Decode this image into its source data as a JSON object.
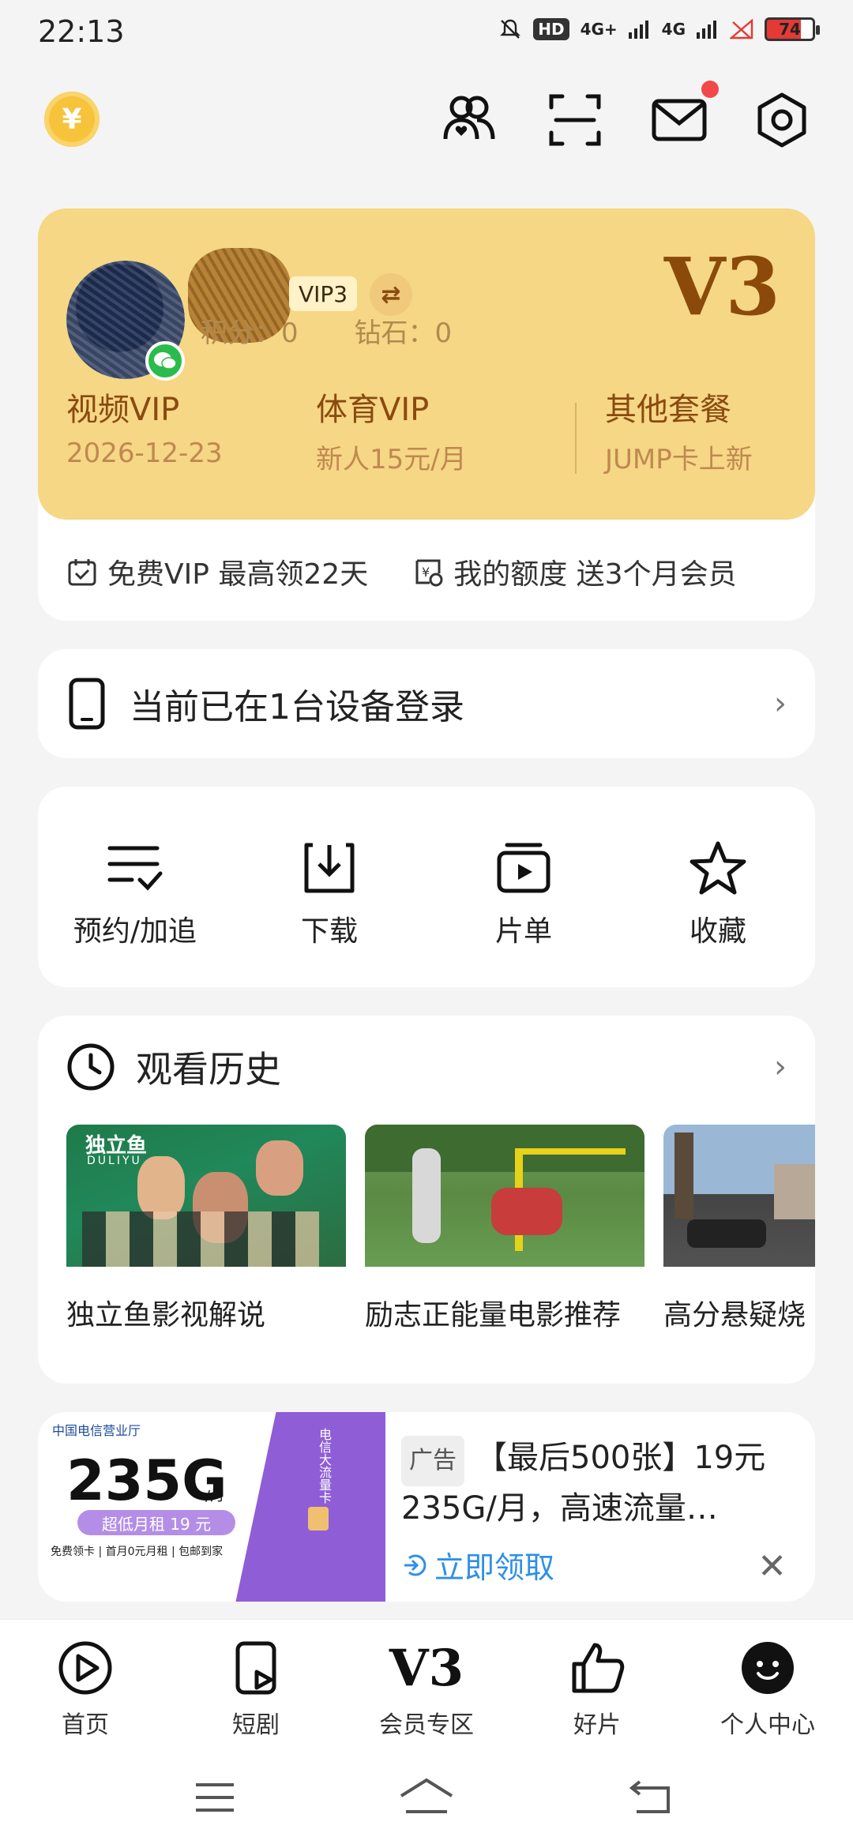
{
  "status_bar": {
    "time": "22:13",
    "hd": "HD",
    "net1": "4G+",
    "net2": "4G",
    "battery": "74"
  },
  "top_bar": {
    "coin_symbol": "¥"
  },
  "vip_card": {
    "level_tag": "VIP3",
    "points_label": "积分：0",
    "diamond_label": "钻石：0",
    "big_level": "V3",
    "benefits": [
      {
        "title": "视频VIP",
        "sub": "2026-12-23"
      },
      {
        "title": "体育VIP",
        "sub": "新人15元/月"
      },
      {
        "title": "其他套餐",
        "sub": "JUMP卡上新"
      }
    ],
    "perks": [
      {
        "label": "免费VIP 最高领22天"
      },
      {
        "label": "我的额度 送3个月会员"
      }
    ]
  },
  "device": {
    "label": "当前已在1台设备登录"
  },
  "actions": [
    {
      "label": "预约/加追"
    },
    {
      "label": "下载"
    },
    {
      "label": "片单"
    },
    {
      "label": "收藏"
    }
  ],
  "history": {
    "title": "观看历史",
    "items": [
      {
        "title": "独立鱼影视解说",
        "logo": "独立鱼",
        "logo_sub": "DULIYU"
      },
      {
        "title": "励志正能量电影推荐"
      },
      {
        "title": "高分悬疑烧"
      }
    ]
  },
  "ad": {
    "tag": "广告",
    "title": "【最后500张】19元235G/月，高速流量…",
    "cta": "立即领取",
    "img_brand": "中国电信营业厅",
    "img_big": "235G",
    "img_unit": "/月",
    "img_price": "超低月租 19 元",
    "img_foot": "免费领卡 | 首月0元月租 | 包邮到家",
    "img_card": "电信大流量卡"
  },
  "bottom_nav": [
    {
      "label": "首页"
    },
    {
      "label": "短剧"
    },
    {
      "label": "会员专区",
      "icon_text": "V3"
    },
    {
      "label": "好片"
    },
    {
      "label": "个人中心"
    }
  ],
  "colors": {
    "vip_gold": "#f5d785",
    "vip_brown": "#8b4a0a",
    "accent_blue": "#2f8fe6",
    "progress_teal": "#3ec4c0"
  }
}
